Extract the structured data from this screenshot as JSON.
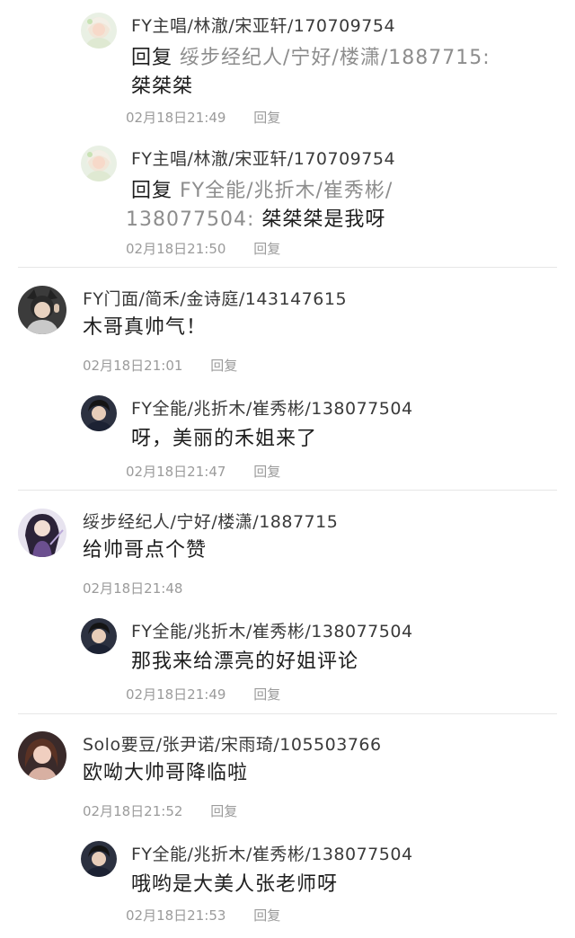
{
  "colors": {
    "divider": "#e6e6e6",
    "meta": "#9b9b9b",
    "reply_target": "#8d8d8d"
  },
  "thread1": {
    "replies": [
      {
        "avatar": "avatar-girl-icon",
        "name": "FY主唱/林澈/宋亚轩/170709754",
        "prefix": "回复",
        "target": "绥步经纪人/宁好/楼潇/1887715:",
        "body": "桀桀桀",
        "time": "02月18日21:49",
        "reply_label": "回复"
      },
      {
        "avatar": "avatar-girl-icon",
        "name": "FY主唱/林澈/宋亚轩/170709754",
        "prefix": "回复",
        "target_line1": "FY全能/兆折木/崔秀彬/",
        "target_line2": "138077504:",
        "body": "桀桀桀是我呀",
        "time": "02月18日21:50",
        "reply_label": "回复"
      }
    ]
  },
  "thread2": {
    "comment": {
      "avatar": "avatar-cat-ears-icon",
      "name": "FY门面/简禾/金诗庭/143147615",
      "text": "木哥真帅气！",
      "time": "02月18日21:01",
      "reply_label": "回复"
    },
    "reply": {
      "avatar": "avatar-boy-icon",
      "name": "FY全能/兆折木/崔秀彬/138077504",
      "text": "呀，美丽的禾姐来了",
      "time": "02月18日21:47",
      "reply_label": "回复"
    }
  },
  "thread3": {
    "comment": {
      "avatar": "avatar-anime-girl-icon",
      "name": "绥步经纪人/宁好/楼潇/1887715",
      "text": "给帅哥点个赞",
      "time": "02月18日21:48"
    },
    "reply": {
      "avatar": "avatar-boy-icon",
      "name": "FY全能/兆折木/崔秀彬/138077504",
      "text": "那我来给漂亮的好姐评论",
      "time": "02月18日21:49",
      "reply_label": "回复"
    }
  },
  "thread4": {
    "comment": {
      "avatar": "avatar-woman-icon",
      "name": "Solo要豆/张尹诺/宋雨琦/105503766",
      "text": "欧呦大帅哥降临啦",
      "time": "02月18日21:52",
      "reply_label": "回复"
    },
    "reply": {
      "avatar": "avatar-boy-icon",
      "name": "FY全能/兆折木/崔秀彬/138077504",
      "text": "哦哟是大美人张老师呀",
      "time": "02月18日21:53",
      "reply_label": "回复"
    }
  }
}
